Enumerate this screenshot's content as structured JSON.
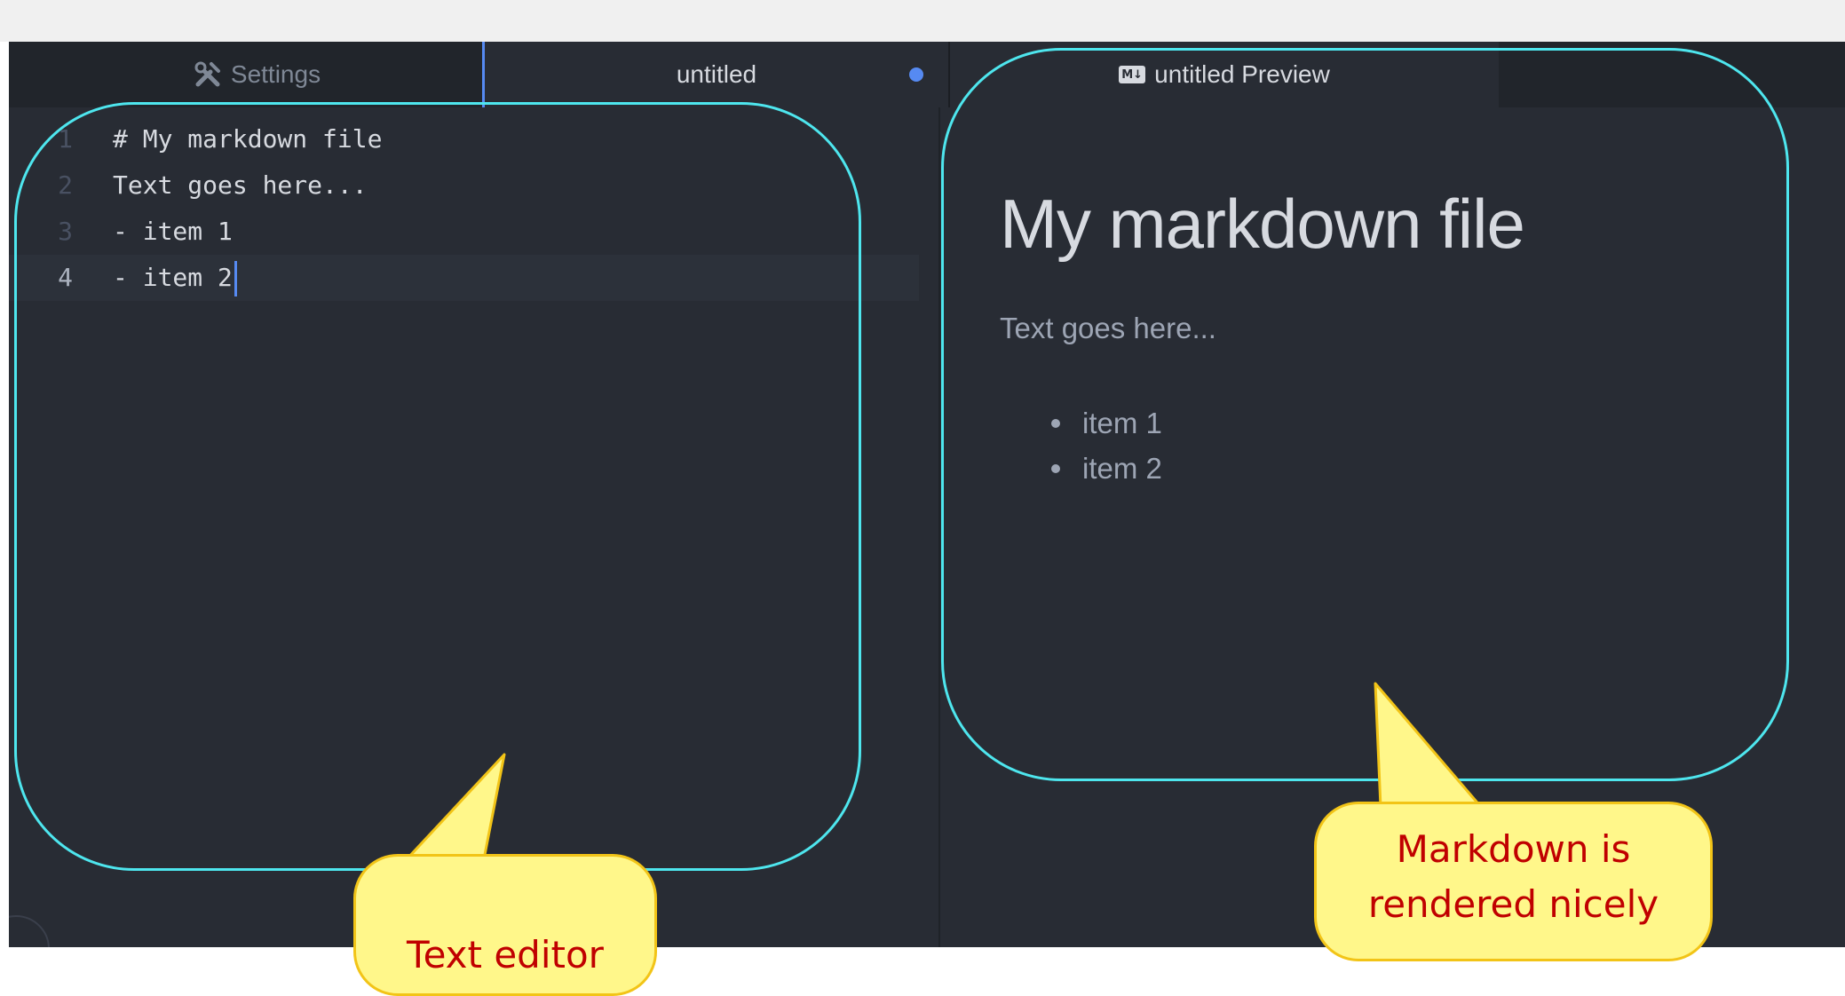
{
  "tabs": {
    "settings": {
      "label": "Settings",
      "icon": "tools-icon"
    },
    "untitled": {
      "label": "untitled",
      "modified": true
    },
    "preview": {
      "label": "untitled Preview",
      "badge": "M↓",
      "icon": "markdown-icon"
    }
  },
  "editor": {
    "lines": [
      {
        "number": "1",
        "text": "# My markdown file"
      },
      {
        "number": "2",
        "text": "Text goes here..."
      },
      {
        "number": "3",
        "text": "- item 1"
      },
      {
        "number": "4",
        "text": "- item 2"
      }
    ],
    "active_line": 4
  },
  "preview": {
    "heading": "My markdown file",
    "paragraph": "Text goes here...",
    "items": [
      "item 1",
      "item 2"
    ]
  },
  "callouts": {
    "editor": "Text editor",
    "preview_line1": "Markdown is",
    "preview_line2": "rendered nicely"
  },
  "colors": {
    "accent": "#568af2",
    "highlight_outline": "#4ee6ee",
    "callout_fill": "#fff78a",
    "callout_text": "#c00000"
  }
}
